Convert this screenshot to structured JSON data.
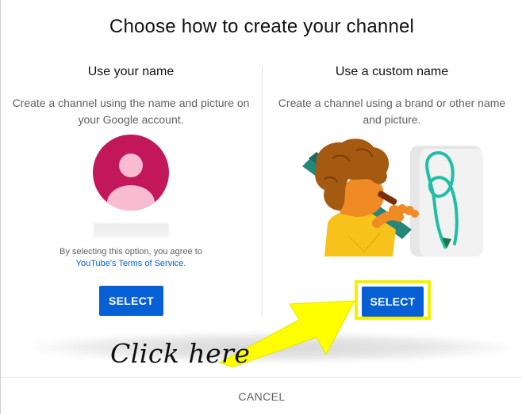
{
  "dialog": {
    "title": "Choose how to create your channel",
    "cancel_label": "CANCEL"
  },
  "left_option": {
    "title": "Use your name",
    "description": "Create a channel using the name and picture on your Google account.",
    "agree_text": "By selecting this option, you agree to",
    "terms_link": "YouTube's Terms of Service",
    "terms_suffix": ".",
    "select_label": "SELECT",
    "avatar_icon": "person-icon"
  },
  "right_option": {
    "title": "Use a custom name",
    "description": "Create a channel using a brand or other name and picture.",
    "select_label": "SELECT",
    "illustration": "person-painting-illustration"
  },
  "annotation": {
    "text": "Click here",
    "arrow_icon": "arrow-icon",
    "highlight_color": "#f2f200"
  },
  "colors": {
    "button_blue": "#065fd4",
    "avatar_red": "#c2185b",
    "link_blue": "#065fd4"
  }
}
